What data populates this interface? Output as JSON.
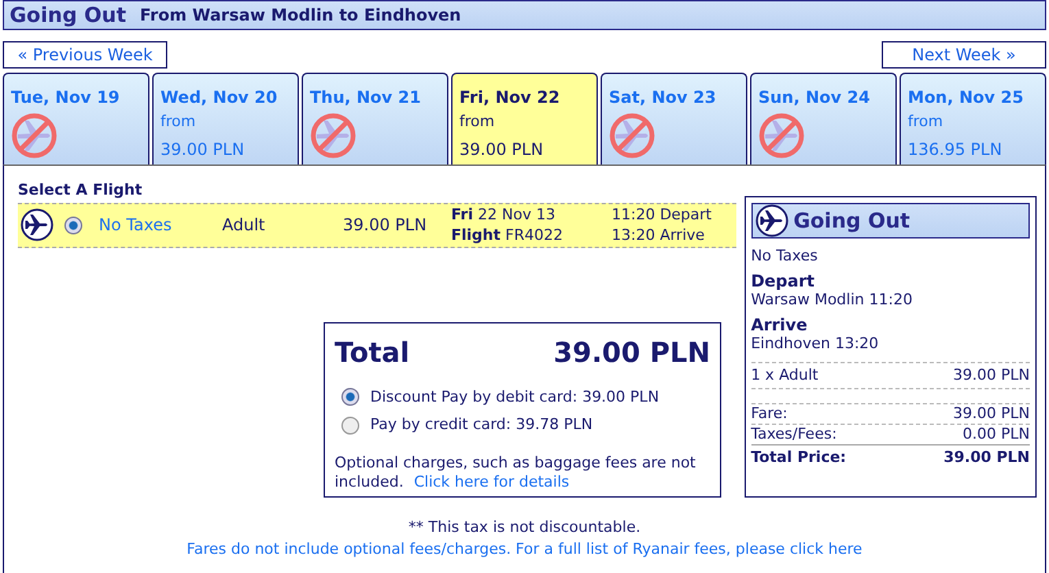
{
  "header": {
    "title": "Going Out",
    "route": "From Warsaw Modlin to Eindhoven"
  },
  "nav": {
    "previous": "« Previous Week",
    "next": "Next Week »"
  },
  "days": [
    {
      "label": "Tue, Nov 19",
      "available": false,
      "selected": false
    },
    {
      "label": "Wed, Nov 20",
      "available": true,
      "from": "from",
      "price": "39.00 PLN",
      "selected": false
    },
    {
      "label": "Thu, Nov 21",
      "available": false,
      "selected": false
    },
    {
      "label": "Fri, Nov 22",
      "available": true,
      "from": "from",
      "price": "39.00 PLN",
      "selected": true
    },
    {
      "label": "Sat, Nov 23",
      "available": false,
      "selected": false
    },
    {
      "label": "Sun, Nov 24",
      "available": false,
      "selected": false
    },
    {
      "label": "Mon, Nov 25",
      "available": true,
      "from": "from",
      "price": "136.95 PLN",
      "selected": false
    }
  ],
  "select_title": "Select A Flight",
  "flights": [
    {
      "selected": true,
      "fare_type": "No Taxes",
      "passenger": "Adult",
      "price": "39.00 PLN",
      "schedule": "**Fri** 22 Nov 13",
      "flight": "**Flight** FR4022",
      "depart": "11:20 Depart",
      "arrive": "13:20 Arrive"
    }
  ],
  "total": {
    "label": "Total",
    "amount": "39.00 PLN",
    "options": [
      {
        "label": "Discount Pay by debit card: 39.00 PLN",
        "selected": true
      },
      {
        "label": "Pay by credit card: 39.78 PLN",
        "selected": false
      }
    ],
    "note": "Optional charges, such as baggage fees are not included.",
    "link": "Click here for details"
  },
  "summary": {
    "title": "Going Out",
    "fare_type": "No Taxes",
    "depart_label": "Depart",
    "depart": "Warsaw Modlin 11:20",
    "arrive_label": "Arrive",
    "arrive": "Eindhoven 13:20",
    "lines": [
      {
        "kind": "item",
        "label": "1 x Adult",
        "value": "39.00 PLN"
      },
      {
        "kind": "fare",
        "label": "Fare:",
        "value": "39.00 PLN"
      },
      {
        "kind": "fare",
        "label": "Taxes/Fees:",
        "value": "0.00 PLN"
      },
      {
        "kind": "total",
        "label": "Total Price:",
        "value": "39.00 PLN"
      }
    ]
  },
  "footer": {
    "note": "** This tax is not discountable.",
    "link": "Fares do not include optional fees/charges. For a full list of Ryanair fees, please click here"
  }
}
